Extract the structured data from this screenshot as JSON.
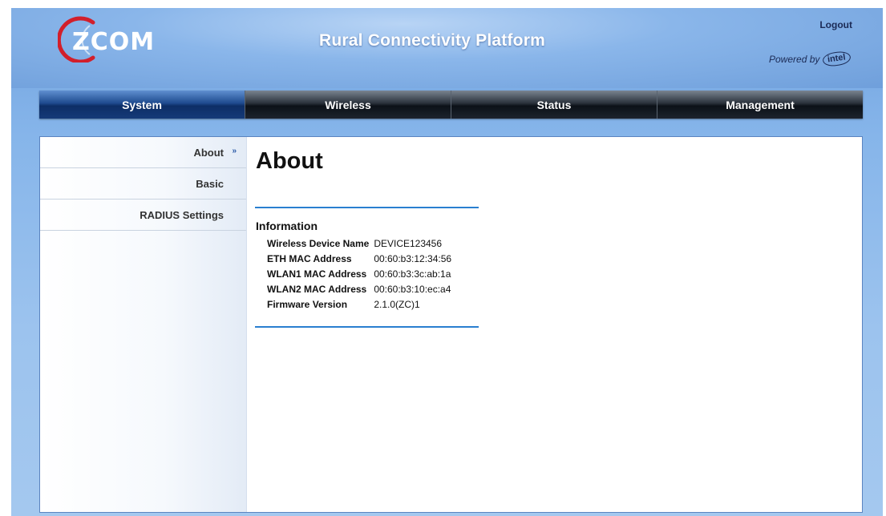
{
  "header": {
    "brand": "ZCOM",
    "title": "Rural Connectivity Platform",
    "logout": "Logout",
    "powered_by": "Powered by",
    "powered_logo": "intel"
  },
  "nav": {
    "items": [
      "System",
      "Wireless",
      "Status",
      "Management"
    ],
    "active": "System"
  },
  "sidebar": {
    "items": [
      {
        "label": "About",
        "active": true,
        "arrow": "»"
      },
      {
        "label": "Basic"
      },
      {
        "label": "RADIUS Settings"
      }
    ]
  },
  "main": {
    "title": "About",
    "section_title": "Information",
    "rows": [
      {
        "key": "Wireless Device Name",
        "value": "DEVICE123456"
      },
      {
        "key": "ETH MAC Address",
        "value": "00:60:b3:12:34:56"
      },
      {
        "key": "WLAN1 MAC Address",
        "value": "00:60:b3:3c:ab:1a"
      },
      {
        "key": "WLAN2 MAC Address",
        "value": "00:60:b3:10:ec:a4"
      },
      {
        "key": "Firmware Version",
        "value": "2.1.0(ZC)1"
      }
    ]
  },
  "colors": {
    "nav_active": "#153a78",
    "nav_dark": "#1c232d",
    "accent_rule": "#2a7fd0",
    "brand_red": "#d21f2b",
    "brand_text": "#ffffff"
  }
}
